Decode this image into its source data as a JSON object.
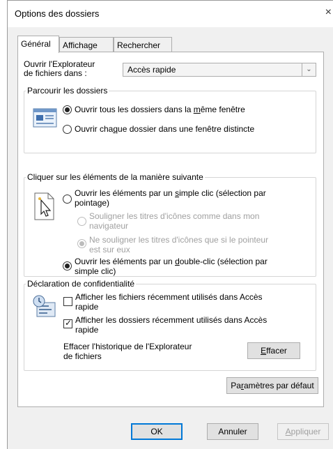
{
  "window": {
    "title": "Options des dossiers",
    "close_glyph": "×"
  },
  "tabs": [
    {
      "label": "Général",
      "active": true
    },
    {
      "label": "Affichage",
      "active": false
    },
    {
      "label": "Rechercher",
      "active": false
    }
  ],
  "open_explorer": {
    "label_line1": "Ouvrir l'Explorateur",
    "label_line2": "de fichiers dans :",
    "selected": "Accès rapide"
  },
  "browse_folders": {
    "legend": "Parcourir les dossiers",
    "icon": "folder-window-icon",
    "options": [
      {
        "pre": "Ouvrir tous les dossiers dans la ",
        "u": "m",
        "post": "ême fenêtre",
        "checked": true
      },
      {
        "pre": "Ouvrir cha",
        "u": "q",
        "post": "ue dossier dans une fenêtre distincte",
        "checked": false
      }
    ]
  },
  "click_items": {
    "legend": "Cliquer sur les éléments de la manière suivante",
    "icon": "pointer-cursor-icon",
    "single_click": {
      "pre": "Ouvrir les éléments par un ",
      "u": "s",
      "post": "imple clic (sélection par",
      "line2": "pointage)",
      "checked": false
    },
    "sub_underline_always": {
      "line1": "Souligner les titres d'icônes comme dans mon",
      "line2": "navigateur",
      "checked": false
    },
    "sub_underline_hover": {
      "line1": "Ne souligner les titres d'icônes que si le pointeur",
      "line2": "est sur eux",
      "checked": true
    },
    "double_click": {
      "pre": "Ouvrir les éléments par un ",
      "u": "d",
      "post": "ouble-clic (sélection par",
      "line2": "simple clic)",
      "checked": true
    }
  },
  "privacy": {
    "legend": "Déclaration de confidentialité",
    "icon": "privacy-files-icon",
    "show_recent_files": {
      "line1": "Afficher les fichiers récemment utilisés dans Accès",
      "line2": "rapide",
      "checked": false
    },
    "show_recent_folders": {
      "line1": "Afficher les dossiers récemment utilisés dans Accès",
      "line2": "rapide",
      "checked": true
    },
    "clear_history_line1": "Effacer l'historique de l'Explorateur",
    "clear_history_line2": "de fichiers",
    "clear_button": {
      "u": "E",
      "post": "ffacer"
    }
  },
  "restore_defaults": {
    "pre": "Pa",
    "u": "r",
    "post": "amètres par défaut"
  },
  "footer": {
    "ok": "OK",
    "cancel": "Annuler",
    "apply_u": "A",
    "apply_post": "ppliquer"
  }
}
